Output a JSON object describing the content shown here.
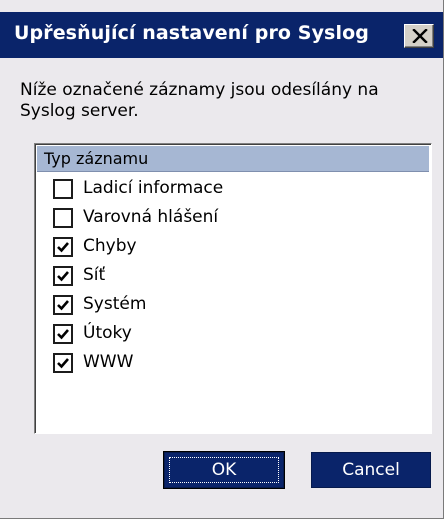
{
  "window": {
    "title": "Upřesňující nastavení pro Syslog"
  },
  "description": "Níže označené záznamy jsou odesílány na Syslog server.",
  "list": {
    "header": "Typ záznamu",
    "items": [
      {
        "label": "Ladicí informace",
        "checked": false
      },
      {
        "label": "Varovná hlášení",
        "checked": false
      },
      {
        "label": "Chyby",
        "checked": true
      },
      {
        "label": "Síť",
        "checked": true
      },
      {
        "label": "Systém",
        "checked": true
      },
      {
        "label": "Útoky",
        "checked": true
      },
      {
        "label": "WWW",
        "checked": true
      }
    ]
  },
  "buttons": {
    "ok": "OK",
    "cancel": "Cancel"
  },
  "colors": {
    "titlebar": "#0a246a",
    "dialog_bg": "#ebe9ed",
    "list_header": "#a6b7d3",
    "button_bg": "#0a246a"
  },
  "icons": {
    "close": "close-icon",
    "check": "checkmark-icon"
  }
}
